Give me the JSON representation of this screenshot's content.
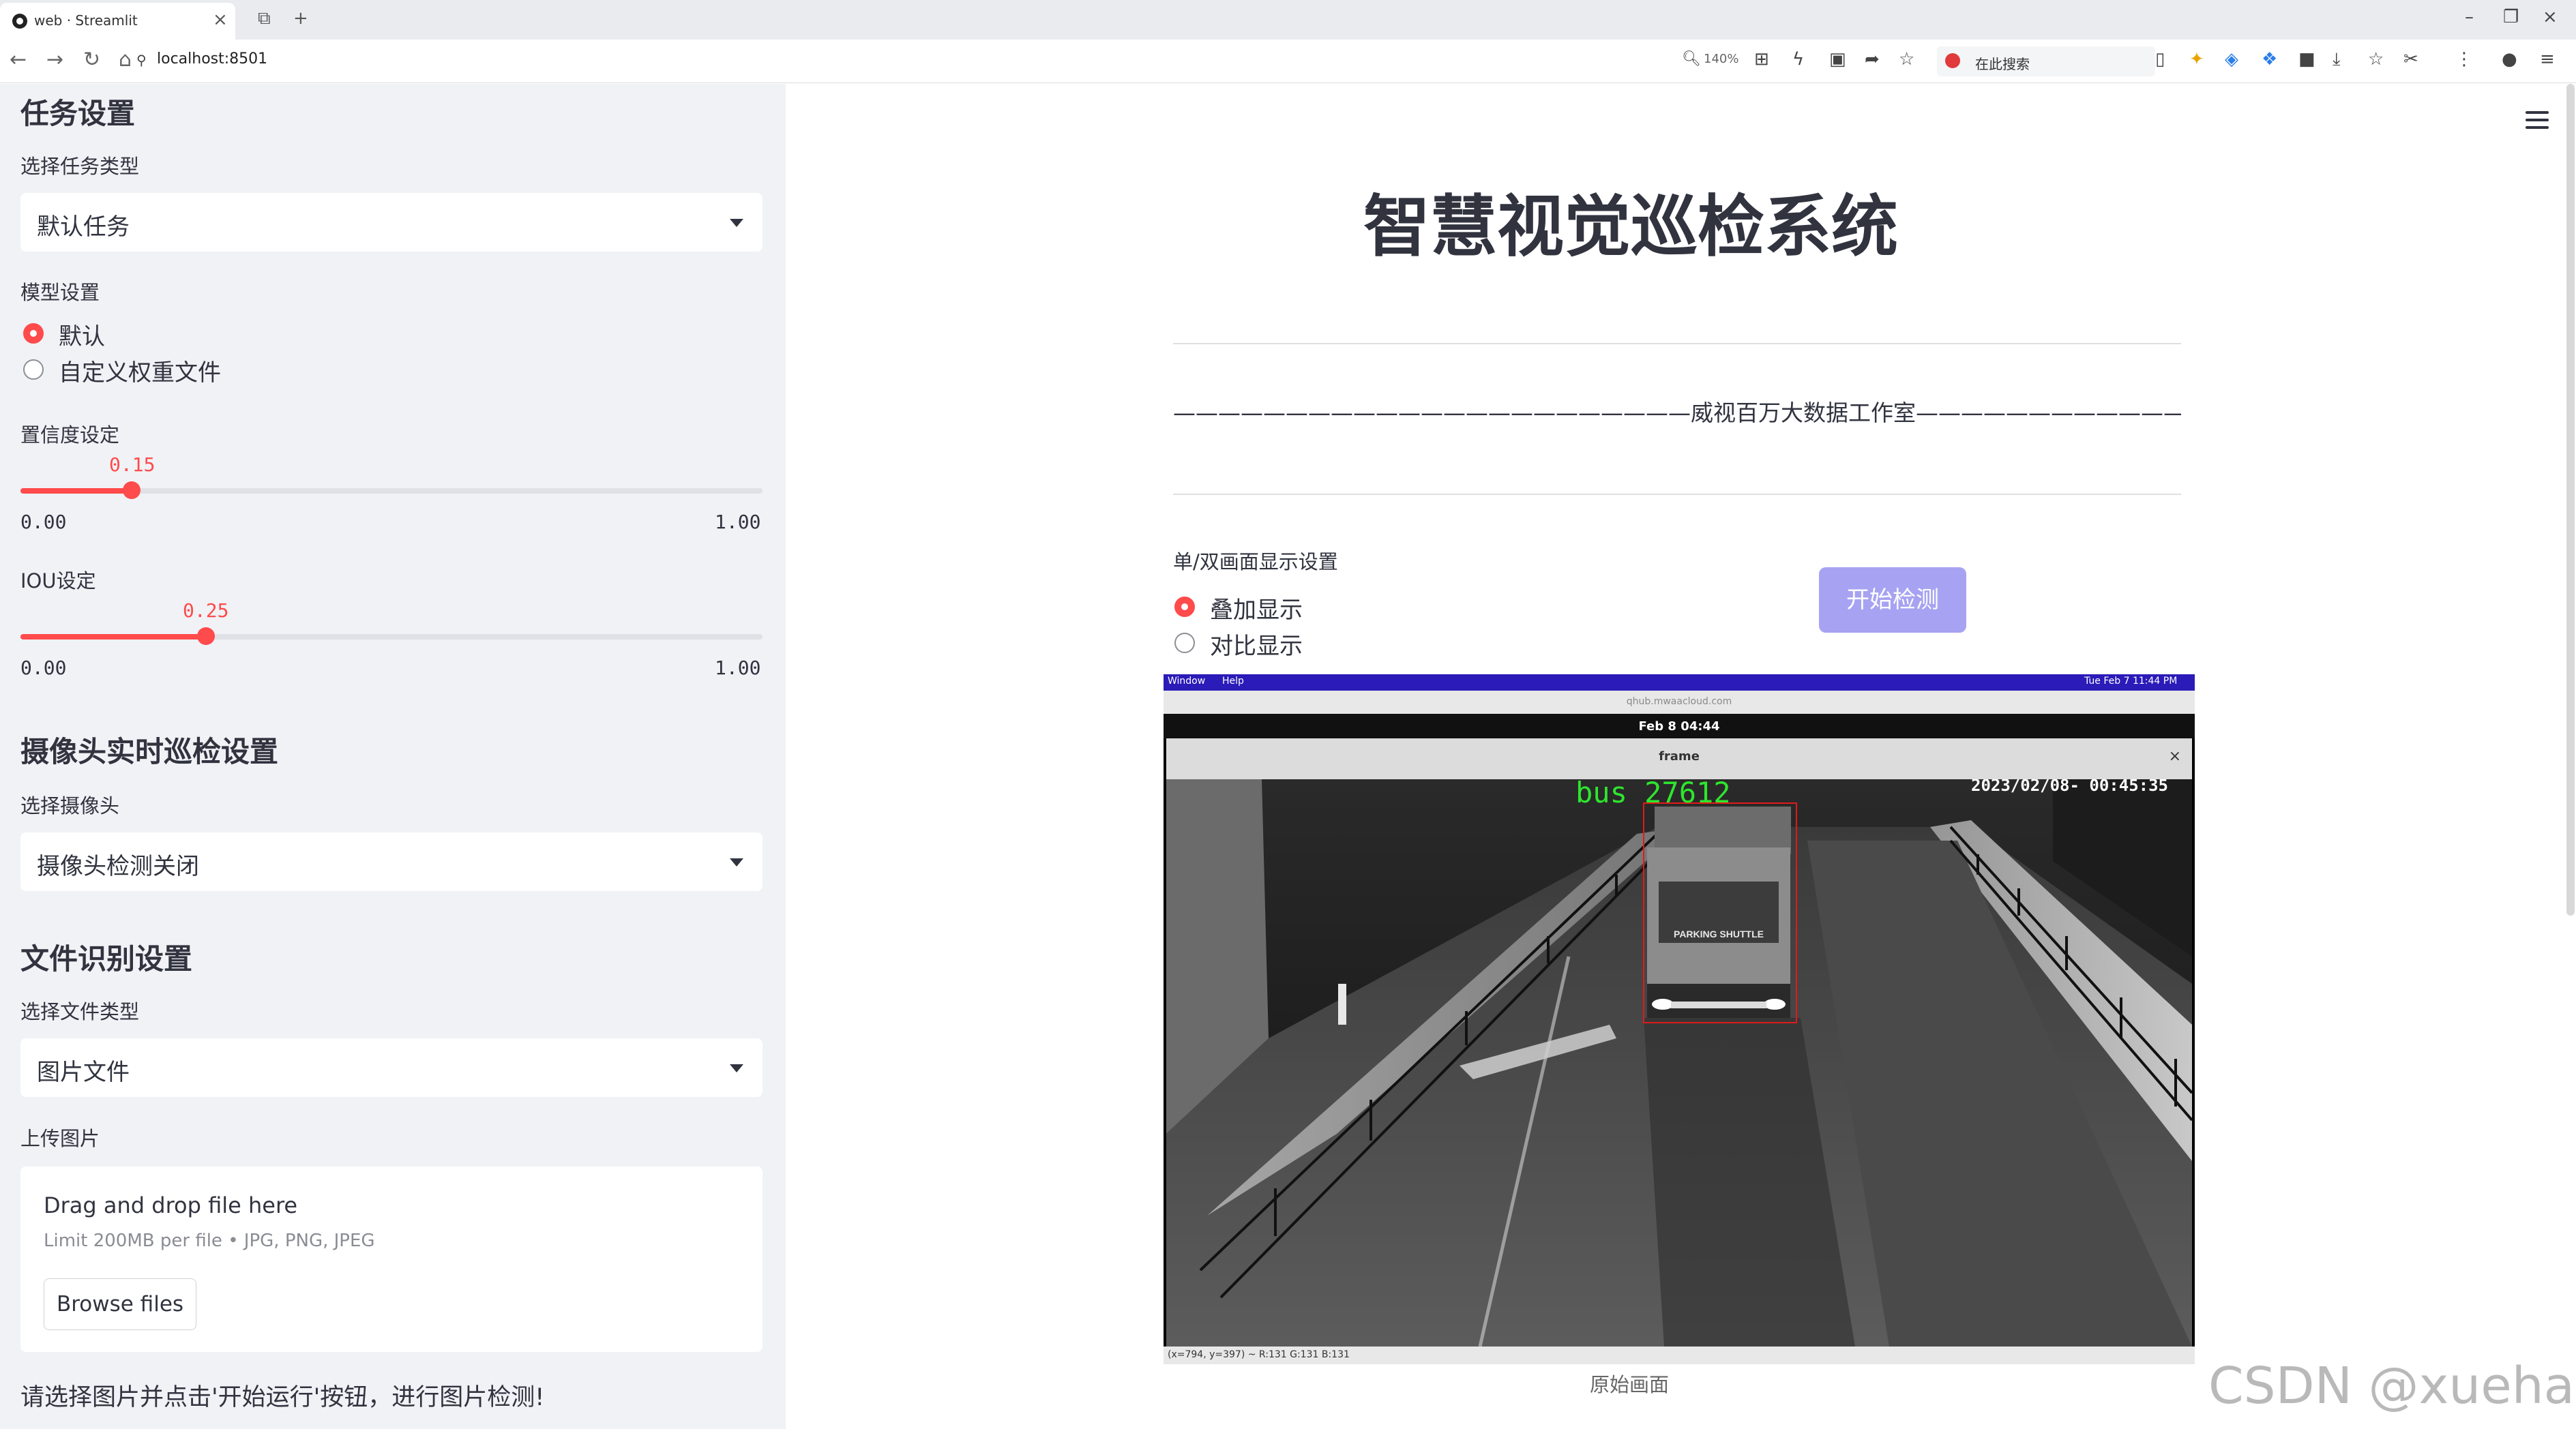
{
  "browser": {
    "tab_title": "web · Streamlit",
    "url": "localhost:8501",
    "zoom": "140%",
    "search_label": "在此搜索"
  },
  "sidebar": {
    "task_section_title": "任务设置",
    "task_type_label": "选择任务类型",
    "task_type_value": "默认任务",
    "model_label": "模型设置",
    "model_options": [
      "默认",
      "自定义权重文件"
    ],
    "model_selected": "默认",
    "conf_label": "置信度设定",
    "conf_value": "0.15",
    "conf_min": "0.00",
    "conf_max": "1.00",
    "iou_label": "IOU设定",
    "iou_value": "0.25",
    "iou_min": "0.00",
    "iou_max": "1.00",
    "camera_section_title": "摄像头实时巡检设置",
    "camera_label": "选择摄像头",
    "camera_value": "摄像头检测关闭",
    "file_section_title": "文件识别设置",
    "file_type_label": "选择文件类型",
    "file_type_value": "图片文件",
    "upload_label": "上传图片",
    "upload_drag_text": "Drag and drop file here",
    "upload_limit_text": "Limit 200MB per file • JPG, PNG, JPEG",
    "browse_button": "Browse files",
    "hint_text": "请选择图片并点击'开始运行'按钮，进行图片检测!"
  },
  "main": {
    "title": "智慧视觉巡检系统",
    "banner": "———————————————————————威视百万大数据工作室————————————————————————",
    "display_label": "单/双画面显示设置",
    "display_options": [
      "叠加显示",
      "对比显示"
    ],
    "display_selected": "叠加显示",
    "start_button": "开始检测",
    "image_caption": "原始画面"
  },
  "screenshot": {
    "menu_window": "Window",
    "menu_help": "Help",
    "clock": "Tue Feb 7  11:44 PM",
    "remote_url": "qhub.mwaacloud.com",
    "date_bar": "Feb 8  04:44",
    "window_title": "frame",
    "cam_timestamp": "2023/02/08- 00:45:35",
    "detection_label": "bus 27612",
    "bus_sign": "PARKING SHUTTLE",
    "status_text": "(x=794, y=397) ~ R:131 G:131 B:131"
  },
  "watermark": "CSDN @xuehaikj",
  "colors": {
    "accent": "#ff4b4b",
    "sidebar_bg": "#f0f2f6",
    "button_primary": "#a7a3f2",
    "detection_box": "#e01a1a",
    "detection_text": "#2ee62e"
  }
}
